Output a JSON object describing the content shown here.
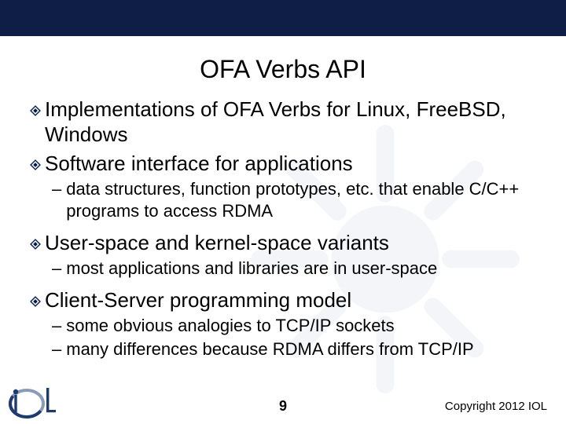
{
  "title": "OFA Verbs API",
  "bullets": [
    {
      "text": "Implementations of OFA Verbs for Linux, FreeBSD, Windows"
    },
    {
      "text": "Software interface for applications",
      "sub": [
        "data structures, function prototypes, etc. that enable C/C++ programs to access RDMA"
      ]
    },
    {
      "text": "User-space and kernel-space variants",
      "sub": [
        "most applications and libraries are in user-space"
      ]
    },
    {
      "text": "Client-Server programming model",
      "sub": [
        "some obvious analogies to TCP/IP sockets",
        "many differences because RDMA differs from TCP/IP"
      ]
    }
  ],
  "page_number": "9",
  "copyright": "Copyright 2012 IOL"
}
